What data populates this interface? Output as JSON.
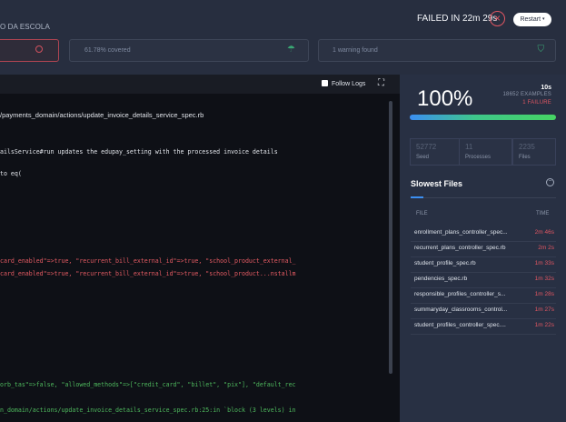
{
  "header": {
    "app_title": "O DA ESCOLA",
    "status": "FAILED IN 22m 29s",
    "fail_icon": "×",
    "restart_label": "Restart",
    "restart_caret": "▾",
    "coverage": "61.78% covered",
    "warnings": "1 warning found"
  },
  "console": {
    "follow_label": "Follow Logs",
    "lines": [
      "/payments_domain/actions/update_invoice_details_service_spec.rb",
      "ailsService#run updates the edupay_setting with the processed invoice details",
      "to eq(",
      "card_enabled\"=>true, \"recurrent_bill_external_id\"=>true, \"school_product_external_",
      "card_enabled\"=>true, \"recurrent_bill_external_id\"=>true, \"school_product...nstallm",
      "orb_tas\"=>false, \"allowed_methods\"=>[\"credit_card\", \"billet\", \"pix\"], \"default_rec",
      "n_domain/actions/update_invoice_details_service_spec.rb:25:in `block (3 levels) in"
    ]
  },
  "summary": {
    "percent": "100%",
    "duration": "10s",
    "examples": "18652 EXAMPLES",
    "failures": "1 FAILURE",
    "stats": [
      {
        "value": "52772",
        "label": "Seed"
      },
      {
        "value": "11",
        "label": "Processes"
      },
      {
        "value": "2235",
        "label": "Files"
      }
    ]
  },
  "slowest": {
    "title": "Slowest Files",
    "collapse_glyph": "−",
    "col_file": "FILE",
    "col_time": "TIME",
    "rows": [
      {
        "file": "enrollment_plans_controller_spec...",
        "time": "2m 46s"
      },
      {
        "file": "recurrent_plans_controller_spec.rb",
        "time": "2m 2s"
      },
      {
        "file": "student_profile_spec.rb",
        "time": "1m 33s"
      },
      {
        "file": "pendencies_spec.rb",
        "time": "1m 32s"
      },
      {
        "file": "responsible_profiles_controller_s...",
        "time": "1m 28s"
      },
      {
        "file": "summaryday_classrooms_control...",
        "time": "1m 27s"
      },
      {
        "file": "student_profiles_controller_spec....",
        "time": "1m 22s"
      }
    ]
  },
  "colors": {
    "fail": "#e05662",
    "success": "#3aa774",
    "accent": "#3c8ff2"
  },
  "icons": [
    "location-pin-icon",
    "umbrella-icon",
    "warning-shield-icon",
    "checkbox-icon",
    "fullscreen-icon",
    "collapse-icon"
  ]
}
